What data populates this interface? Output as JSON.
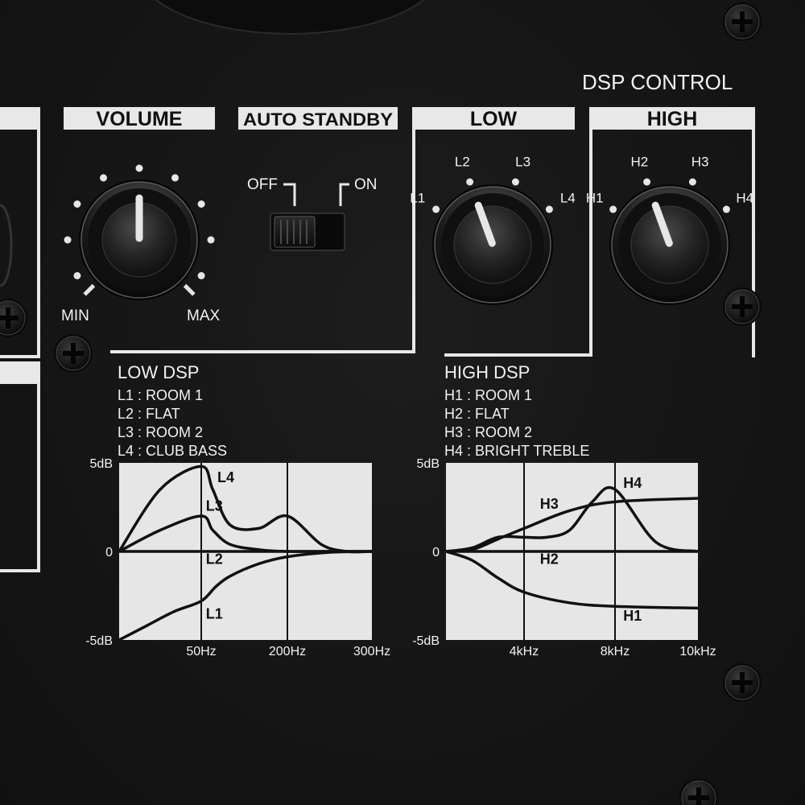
{
  "panel": {
    "dsp_control_title": "DSP CONTROL",
    "volume": {
      "title": "VOLUME",
      "min_label": "MIN",
      "max_label": "MAX",
      "level": 0.5
    },
    "auto_standby": {
      "title": "AUTO STANDBY",
      "off_label": "OFF",
      "on_label": "ON",
      "state": "OFF"
    },
    "low": {
      "title": "LOW",
      "positions": [
        "L1",
        "L2",
        "L3",
        "L4"
      ],
      "selected": "L2"
    },
    "high": {
      "title": "HIGH",
      "positions": [
        "H1",
        "H2",
        "H3",
        "H4"
      ],
      "selected": "H2"
    }
  },
  "low_dsp": {
    "title": "LOW DSP",
    "modes": [
      {
        "id": "L1",
        "text": "L1 : ROOM 1"
      },
      {
        "id": "L2",
        "text": "L2 : FLAT"
      },
      {
        "id": "L3",
        "text": "L3 : ROOM 2"
      },
      {
        "id": "L4",
        "text": "L4 : CLUB BASS"
      }
    ],
    "chart_data": {
      "type": "line",
      "title": "LOW DSP",
      "y_ticks": [
        "5dB",
        "0",
        "-5dB"
      ],
      "x_ticks": [
        "50Hz",
        "200Hz",
        "300Hz"
      ],
      "ylim": [
        -5,
        5
      ],
      "grid": true,
      "x_unit": "Hz",
      "y_unit": "dB",
      "series": [
        {
          "name": "L1",
          "x": [
            20,
            30,
            40,
            50,
            75,
            100,
            150,
            200,
            250,
            300
          ],
          "y": [
            -5,
            -4.2,
            -3.4,
            -2.8,
            -2.0,
            -1.4,
            -0.7,
            -0.3,
            -0.05,
            0
          ]
        },
        {
          "name": "L2",
          "x": [
            20,
            50,
            100,
            200,
            300
          ],
          "y": [
            0,
            0,
            0,
            0,
            0
          ]
        },
        {
          "name": "L3",
          "x": [
            20,
            35,
            50,
            70,
            100,
            150,
            200,
            250,
            300
          ],
          "y": [
            0,
            1.2,
            2.0,
            1.2,
            0.4,
            0.1,
            0,
            0,
            0
          ]
        },
        {
          "name": "L4",
          "x": [
            20,
            35,
            50,
            70,
            100,
            150,
            200,
            240,
            270,
            300
          ],
          "y": [
            0,
            3.5,
            4.8,
            3.5,
            1.5,
            1.3,
            2.0,
            0.4,
            0,
            0
          ]
        }
      ]
    }
  },
  "high_dsp": {
    "title": "HIGH DSP",
    "modes": [
      {
        "id": "H1",
        "text": "H1 : ROOM 1"
      },
      {
        "id": "H2",
        "text": "H2 : FLAT"
      },
      {
        "id": "H3",
        "text": "H3 : ROOM 2"
      },
      {
        "id": "H4",
        "text": "H4 : BRIGHT TREBLE"
      }
    ],
    "chart_data": {
      "type": "line",
      "title": "HIGH DSP",
      "y_ticks": [
        "5dB",
        "0",
        "-5dB"
      ],
      "x_ticks": [
        "4kHz",
        "8kHz",
        "10kHz"
      ],
      "ylim": [
        -5,
        5
      ],
      "grid": true,
      "x_unit": "kHz",
      "y_unit": "dB",
      "series": [
        {
          "name": "H1",
          "x": [
            1,
            2,
            3,
            4,
            6,
            8,
            10
          ],
          "y": [
            0,
            -0.5,
            -1.5,
            -2.3,
            -2.9,
            -3.1,
            -3.2
          ]
        },
        {
          "name": "H2",
          "x": [
            1,
            4,
            8,
            10
          ],
          "y": [
            0,
            0,
            0,
            0
          ]
        },
        {
          "name": "H3",
          "x": [
            1,
            2,
            3,
            4,
            6,
            8,
            10
          ],
          "y": [
            0,
            0.1,
            0.7,
            1.3,
            2.3,
            2.8,
            3.0
          ]
        },
        {
          "name": "H4",
          "x": [
            1,
            2,
            3,
            4,
            5,
            6,
            7,
            8,
            9,
            10
          ],
          "y": [
            0,
            0.2,
            0.8,
            0.8,
            0.8,
            1.2,
            2.8,
            3.5,
            0.5,
            0
          ]
        }
      ]
    }
  },
  "chart_labels": {
    "low": {
      "L1": "L1",
      "L2": "L2",
      "L3": "L3",
      "L4": "L4"
    },
    "high": {
      "H1": "H1",
      "H2": "H2",
      "H3": "H3",
      "H4": "H4"
    }
  }
}
